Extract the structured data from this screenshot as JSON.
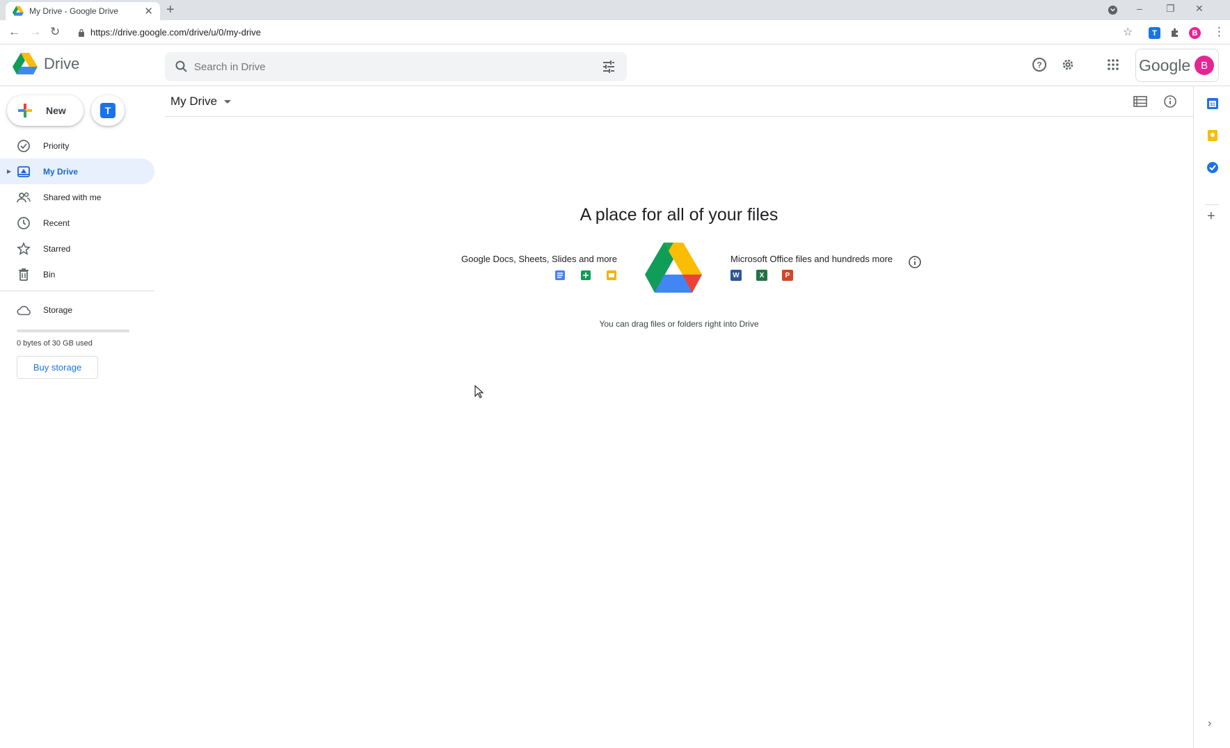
{
  "browser": {
    "tab_title": "My Drive - Google Drive",
    "url": "https://drive.google.com/drive/u/0/my-drive",
    "profile_initial": "B",
    "extension_label": "T"
  },
  "header": {
    "app_name": "Drive",
    "search_placeholder": "Search in Drive",
    "account_word": "Google",
    "avatar_initial": "B"
  },
  "sidebar": {
    "new_label": "New",
    "shortcut_label": "T",
    "items": [
      {
        "label": "Priority",
        "icon": "priority-icon"
      },
      {
        "label": "My Drive",
        "icon": "my-drive-icon",
        "active": true
      },
      {
        "label": "Shared with me",
        "icon": "shared-icon"
      },
      {
        "label": "Recent",
        "icon": "clock-icon"
      },
      {
        "label": "Starred",
        "icon": "star-icon"
      },
      {
        "label": "Bin",
        "icon": "bin-icon"
      }
    ],
    "storage": {
      "label": "Storage",
      "used_text": "0 bytes of 30 GB used",
      "used_fraction": 0,
      "buy_label": "Buy storage"
    }
  },
  "main": {
    "breadcrumb": "My Drive",
    "empty_title": "A place for all of your files",
    "left_caption": "Google Docs, Sheets, Slides and more",
    "right_caption": "Microsoft Office files and hundreds more",
    "drag_hint": "You can drag files or folders right into Drive",
    "office_icons": [
      "W",
      "X",
      "P"
    ]
  },
  "colors": {
    "accent": "#1a73e8",
    "active_bg": "#e8f0fe",
    "docs": "#4285f4",
    "sheets": "#0f9d58",
    "slides": "#f4b400",
    "word": "#2b579a",
    "excel": "#217346",
    "powerpoint": "#d24726"
  }
}
